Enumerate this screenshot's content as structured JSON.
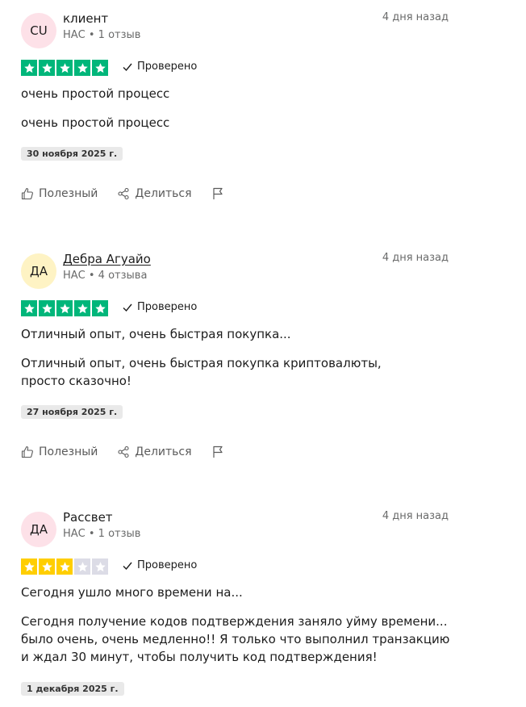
{
  "reviews": [
    {
      "avatar_initials": "CU",
      "avatar_color": "#fde1e8",
      "author": "клиент",
      "author_is_link": false,
      "meta": "НАС • 1 отзыв",
      "date_ago": "4 дня назад",
      "rating": 5,
      "star_color": "#00b67a",
      "verified_label": "Проверено",
      "title": "очень простой процесс",
      "body_lines": [
        "очень простой процесс"
      ],
      "experience_date": "30 ноября 2025 г.",
      "actions": {
        "helpful": "Полезный",
        "share": "Делиться"
      }
    },
    {
      "avatar_initials": "ДА",
      "avatar_color": "#fef3c4",
      "author": "Дебра Агуайо",
      "author_is_link": true,
      "meta": "НАС • 4 отзыва",
      "date_ago": "4 дня назад",
      "rating": 5,
      "star_color": "#00b67a",
      "verified_label": "Проверено",
      "title": "Отличный опыт, очень быстрая покупка...",
      "body_lines": [
        "Отличный опыт, очень быстрая покупка криптовалюты,",
        "просто сказочно!"
      ],
      "experience_date": "27 ноября 2025 г.",
      "actions": {
        "helpful": "Полезный",
        "share": "Делиться"
      }
    },
    {
      "avatar_initials": "ДА",
      "avatar_color": "#fde1e8",
      "author": "Рассвет",
      "author_is_link": false,
      "meta": "НАС • 1 отзыв",
      "date_ago": "4 дня назад",
      "rating": 3,
      "star_color": "#ffce00",
      "verified_label": "Проверено",
      "title": "Сегодня ушло много времени на...",
      "body_lines": [
        "Сегодня получение кодов подтверждения заняло уйму времени...",
        "было очень, очень медленно!! Я только что выполнил транзакцию",
        "и ждал 30 минут, чтобы получить код подтверждения!"
      ],
      "experience_date": "1 декабря 2025 г.",
      "actions": {
        "helpful": "Полезный",
        "share": "Делиться"
      }
    }
  ],
  "empty_star_color": "#dcdce6",
  "verified_check_color": "#1c1c1c"
}
